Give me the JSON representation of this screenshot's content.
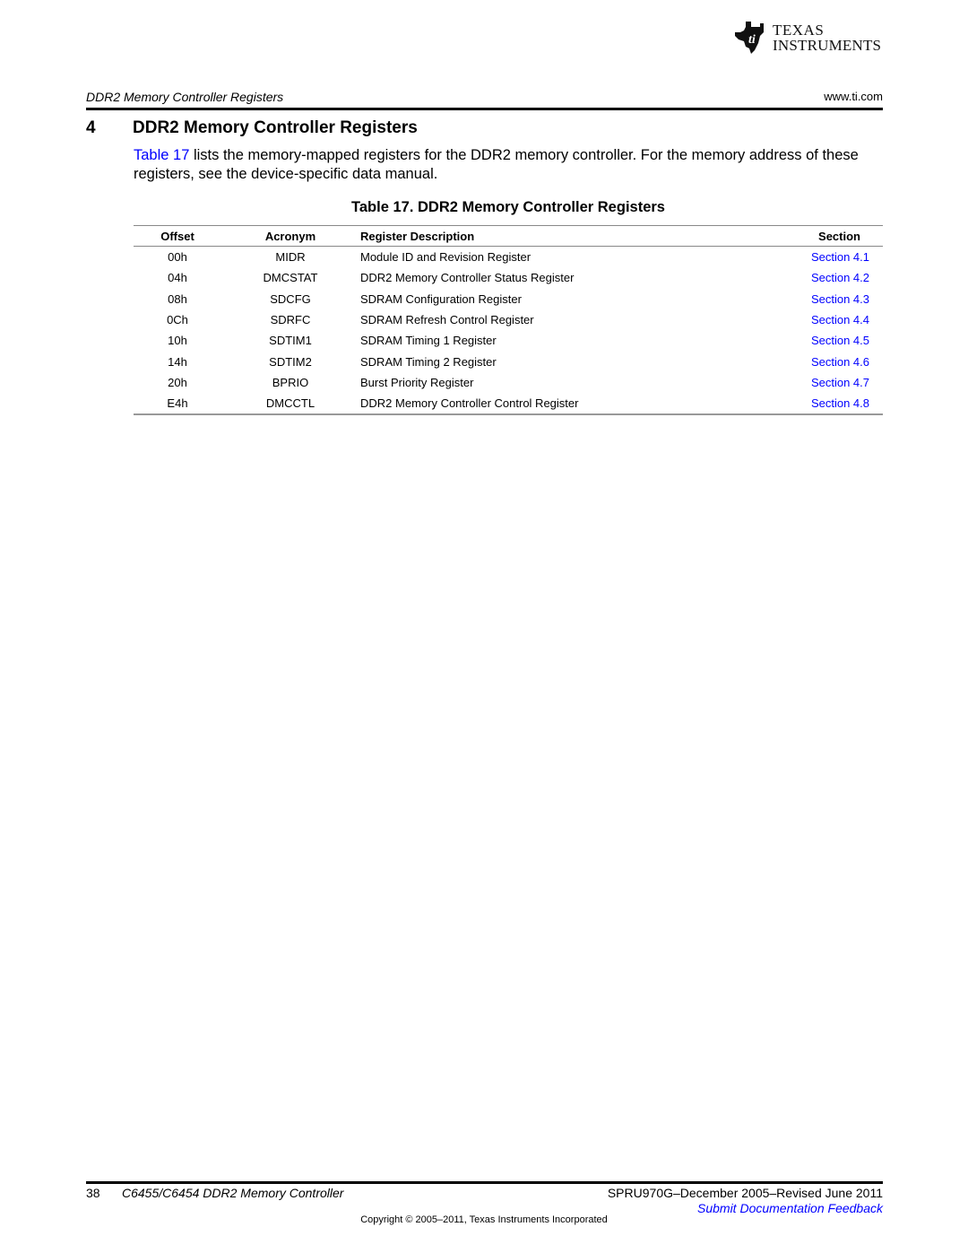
{
  "logo": {
    "line1": "Texas",
    "line2": "Instruments",
    "icon": "ti-logo-icon"
  },
  "running_header": {
    "title": "DDR2 Memory Controller Registers",
    "url": "www.ti.com"
  },
  "section": {
    "number": "4",
    "title": "DDR2 Memory Controller Registers"
  },
  "intro": {
    "link_text": "Table 17",
    "text": " lists the memory-mapped registers for the DDR2 memory controller. For the memory address of these registers, see the device-specific data manual."
  },
  "table": {
    "caption": "Table 17. DDR2 Memory Controller Registers",
    "headers": {
      "offset": "Offset",
      "acronym": "Acronym",
      "description": "Register Description",
      "section": "Section"
    },
    "rows": [
      {
        "offset": "00h",
        "acronym": "MIDR",
        "description": "Module ID and Revision Register",
        "section": "Section 4.1"
      },
      {
        "offset": "04h",
        "acronym": "DMCSTAT",
        "description": "DDR2 Memory Controller Status Register",
        "section": "Section 4.2"
      },
      {
        "offset": "08h",
        "acronym": "SDCFG",
        "description": "SDRAM Configuration Register",
        "section": "Section 4.3"
      },
      {
        "offset": "0Ch",
        "acronym": "SDRFC",
        "description": "SDRAM Refresh Control Register",
        "section": "Section 4.4"
      },
      {
        "offset": "10h",
        "acronym": "SDTIM1",
        "description": "SDRAM Timing 1 Register",
        "section": "Section 4.5"
      },
      {
        "offset": "14h",
        "acronym": "SDTIM2",
        "description": "SDRAM Timing 2 Register",
        "section": "Section 4.6"
      },
      {
        "offset": "20h",
        "acronym": "BPRIO",
        "description": "Burst Priority Register",
        "section": "Section 4.7"
      },
      {
        "offset": "E4h",
        "acronym": "DMCCTL",
        "description": "DDR2 Memory Controller Control Register",
        "section": "Section 4.8"
      }
    ]
  },
  "footer": {
    "page_number": "38",
    "doc_title": "C6455/C6454 DDR2 Memory Controller",
    "doc_id": "SPRU970G–December 2005–Revised June 2011",
    "feedback_link": "Submit Documentation Feedback",
    "copyright": "Copyright © 2005–2011, Texas Instruments Incorporated"
  },
  "colors": {
    "link": "#0000ff",
    "text": "#000000"
  }
}
